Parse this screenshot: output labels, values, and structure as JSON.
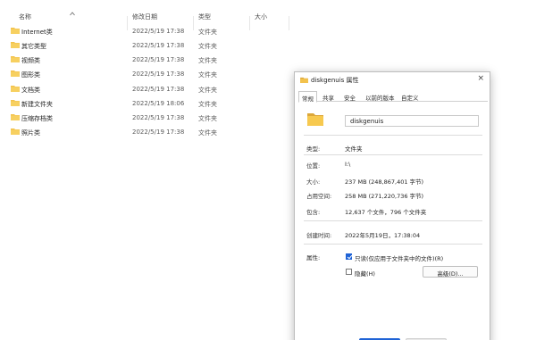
{
  "explorer": {
    "columns": {
      "name": "名称",
      "modified": "修改日期",
      "type": "类型",
      "size": "大小"
    },
    "rows": [
      {
        "name": "Internet类",
        "date": "2022/5/19 17:38",
        "type": "文件夹"
      },
      {
        "name": "其它类型",
        "date": "2022/5/19 17:38",
        "type": "文件夹"
      },
      {
        "name": "视频类",
        "date": "2022/5/19 17:38",
        "type": "文件夹"
      },
      {
        "name": "图形类",
        "date": "2022/5/19 17:38",
        "type": "文件夹"
      },
      {
        "name": "文档类",
        "date": "2022/5/19 17:38",
        "type": "文件夹"
      },
      {
        "name": "新建文件夹",
        "date": "2022/5/19 18:06",
        "type": "文件夹"
      },
      {
        "name": "压缩存档类",
        "date": "2022/5/19 17:38",
        "type": "文件夹"
      },
      {
        "name": "照片类",
        "date": "2022/5/19 17:38",
        "type": "文件夹"
      }
    ]
  },
  "dialog": {
    "title": "diskgenuis 属性",
    "close_glyph": "×",
    "tabs": [
      "常规",
      "共享",
      "安全",
      "以前的版本",
      "自定义"
    ],
    "folder_name": "diskgenuis",
    "props": {
      "type_label": "类型:",
      "type_value": "文件夹",
      "location_label": "位置:",
      "location_value": "I:\\",
      "size_label": "大小:",
      "size_value": "237 MB (248,867,401 字节)",
      "disk_label": "占用空间:",
      "disk_value": "258 MB (271,220,736 字节)",
      "contains_label": "包含:",
      "contains_value": "12,637 个文件，796 个文件夹",
      "created_label": "创建时间:",
      "created_value": "2022年5月19日，17:38:04",
      "attributes_label": "属性:"
    },
    "attributes": {
      "readonly_label": "只读(仅应用于文件夹中的文件)(R)",
      "readonly_checked": true,
      "hidden_label": "隐藏(H)",
      "hidden_checked": false,
      "advanced_label": "高级(D)..."
    }
  },
  "colors": {
    "folder": "#f3c24c",
    "folder_dark": "#dca73a",
    "accent": "#1f63d6"
  }
}
